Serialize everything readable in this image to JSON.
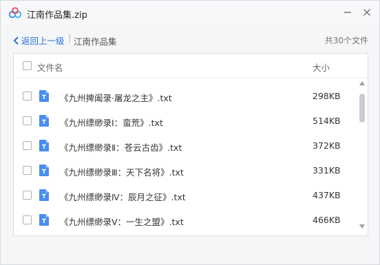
{
  "window": {
    "title": "江南作品集.zip"
  },
  "nav": {
    "back_label": "返回上一级",
    "separator": "|",
    "breadcrumb": "江南作品集",
    "file_count": "共30个文件"
  },
  "table": {
    "col_name": "文件名",
    "col_size": "大小",
    "rows": [
      {
        "name": "《九州捭阖录·屠龙之主》.txt",
        "size": "298KB"
      },
      {
        "name": "《九州缥缈录Ⅰ：蛮荒》.txt",
        "size": "514KB"
      },
      {
        "name": "《九州缥缈录Ⅱ：苍云古齿》.txt",
        "size": "372KB"
      },
      {
        "name": "《九州缥缈录Ⅲ：天下名将》.txt",
        "size": "331KB"
      },
      {
        "name": "《九州缥缈录Ⅳ：辰月之征》.txt",
        "size": "437KB"
      },
      {
        "name": "《九州缥缈录Ⅴ：一生之盟》.txt",
        "size": "466KB"
      }
    ]
  },
  "icons": {
    "logo": "baidu-netdisk-logo",
    "file": "txt-file-icon",
    "back": "chevron-left-icon",
    "minimize": "minimize-icon",
    "close": "close-icon"
  },
  "colors": {
    "accent": "#2b73d9",
    "file_icon": "#4a8df0"
  }
}
